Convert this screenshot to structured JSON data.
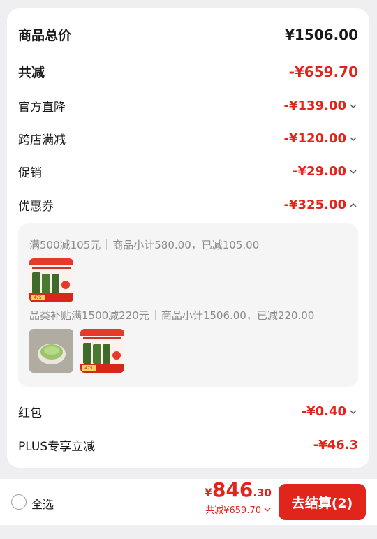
{
  "summary": {
    "total": {
      "label": "商品总价",
      "value": "¥1506.00"
    },
    "reduction": {
      "label": "共减",
      "value": "-¥659.70"
    },
    "items": [
      {
        "label": "官方直降",
        "value": "-¥139.00",
        "icon": "chevron-down-icon"
      },
      {
        "label": "跨店满减",
        "value": "-¥120.00",
        "icon": "chevron-down-icon"
      },
      {
        "label": "促销",
        "value": "-¥29.00",
        "icon": "chevron-down-icon"
      },
      {
        "label": "优惠券",
        "value": "-¥325.00",
        "icon": "chevron-up-icon"
      }
    ]
  },
  "coupons": [
    {
      "title": "满500减105元",
      "detail": "商品小计580.00，已减105.00"
    },
    {
      "title": "品类补贴满1500减220元",
      "detail": "商品小计1506.00，已减220.00"
    }
  ],
  "product_thumbs": {
    "promo_caption": "475",
    "promo_caption_2": "475"
  },
  "extras": [
    {
      "label": "红包",
      "value": "-¥0.40",
      "icon": "chevron-down-icon"
    },
    {
      "label": "PLUS专享立减",
      "value": "-¥46.3"
    }
  ],
  "bottom": {
    "select_all": "全选",
    "price_currency": "¥",
    "price_int": "846",
    "price_dec": ".30",
    "reduction_text": "共减¥659.70",
    "checkout": "去结算(2)"
  },
  "colors": {
    "accent": "#e1251b",
    "price": "#e4231a",
    "background": "#efeff1"
  }
}
